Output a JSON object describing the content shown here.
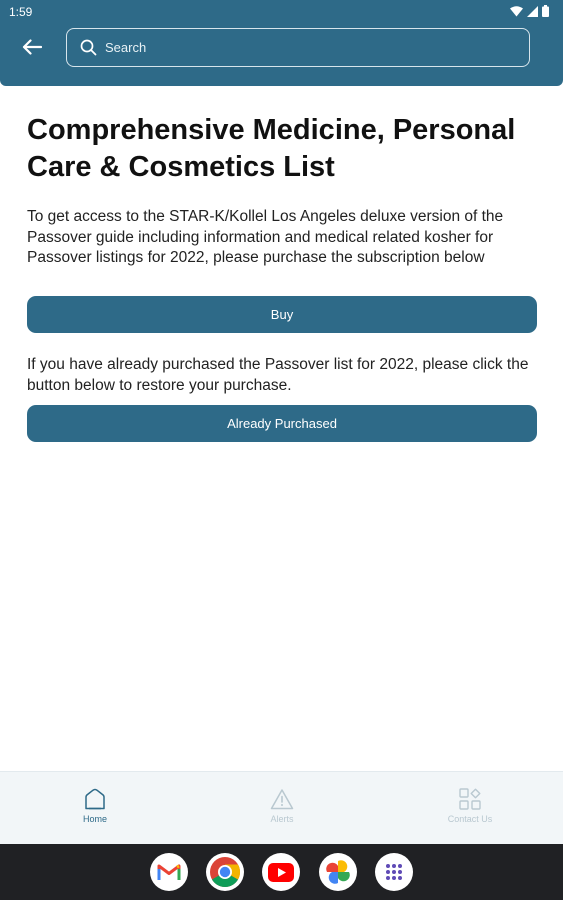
{
  "status_bar": {
    "time": "1:59"
  },
  "search": {
    "placeholder": "Search"
  },
  "content": {
    "title": "Comprehensive Medicine, Personal Care & Cosmetics List",
    "purchase_text": "To get access to the STAR-K/Kollel Los Angeles deluxe version of the Passover guide including information and medical related kosher for Passover listings for 2022, please purchase the subscription below",
    "buy_label": "Buy",
    "restore_text": "If you have already purchased the Passover list for 2022, please click the button below to restore your purchase.",
    "restore_label": "Already Purchased"
  },
  "bottom_nav": {
    "items": [
      {
        "label": "Home",
        "icon": "home-icon",
        "active": true
      },
      {
        "label": "Alerts",
        "icon": "alert-icon",
        "active": false
      },
      {
        "label": "Contact Us",
        "icon": "grid-icon",
        "active": false
      }
    ]
  },
  "dock": {
    "apps": [
      "gmail-icon",
      "chrome-icon",
      "youtube-icon",
      "photos-icon",
      "app-drawer-icon"
    ]
  },
  "colors": {
    "primary": "#2e6a88",
    "nav_background": "#f2f6f8",
    "inactive": "#b9c8d0",
    "dock": "#202124"
  }
}
